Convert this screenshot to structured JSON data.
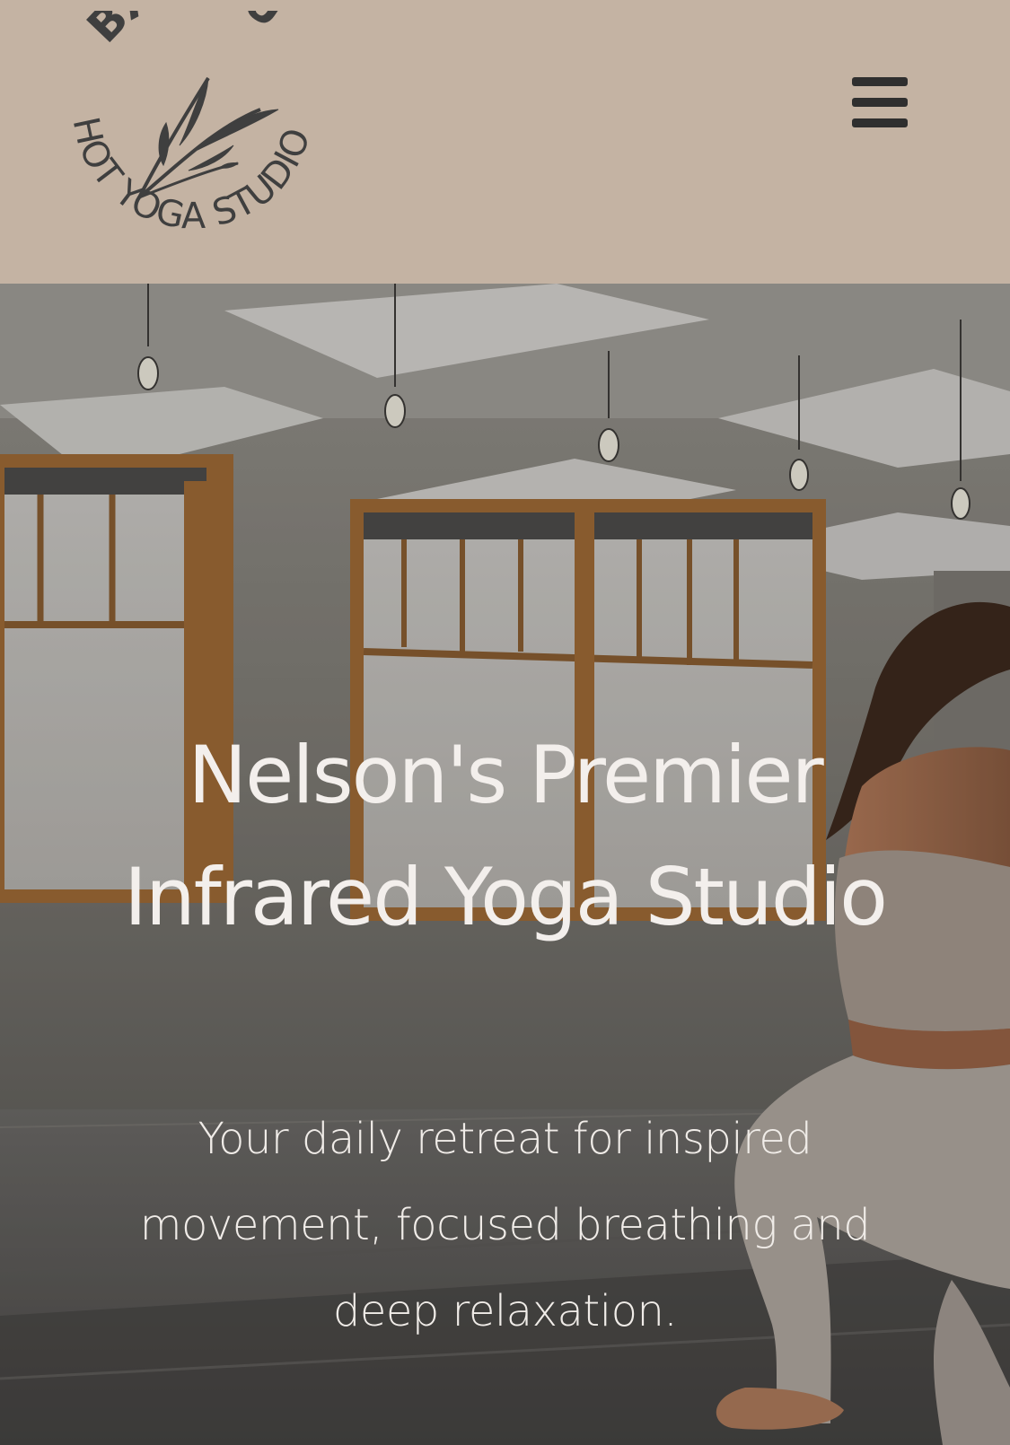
{
  "header": {
    "background_color": "#c4b3a3",
    "logo": {
      "top_text": "BAMBU",
      "bottom_text": "HOT YOGA STUDIO",
      "icon": "bamboo-leaves-icon",
      "color": "#3f3f3f"
    },
    "menu_icon": "hamburger-menu-icon"
  },
  "hero": {
    "title": "Nelson's Premier Infrared Yoga Studio",
    "subtitle": "Your daily retreat for inspired movement, focused breathing and deep relaxation.",
    "text_color": "#f3efec",
    "background": "yoga-studio-photo"
  }
}
